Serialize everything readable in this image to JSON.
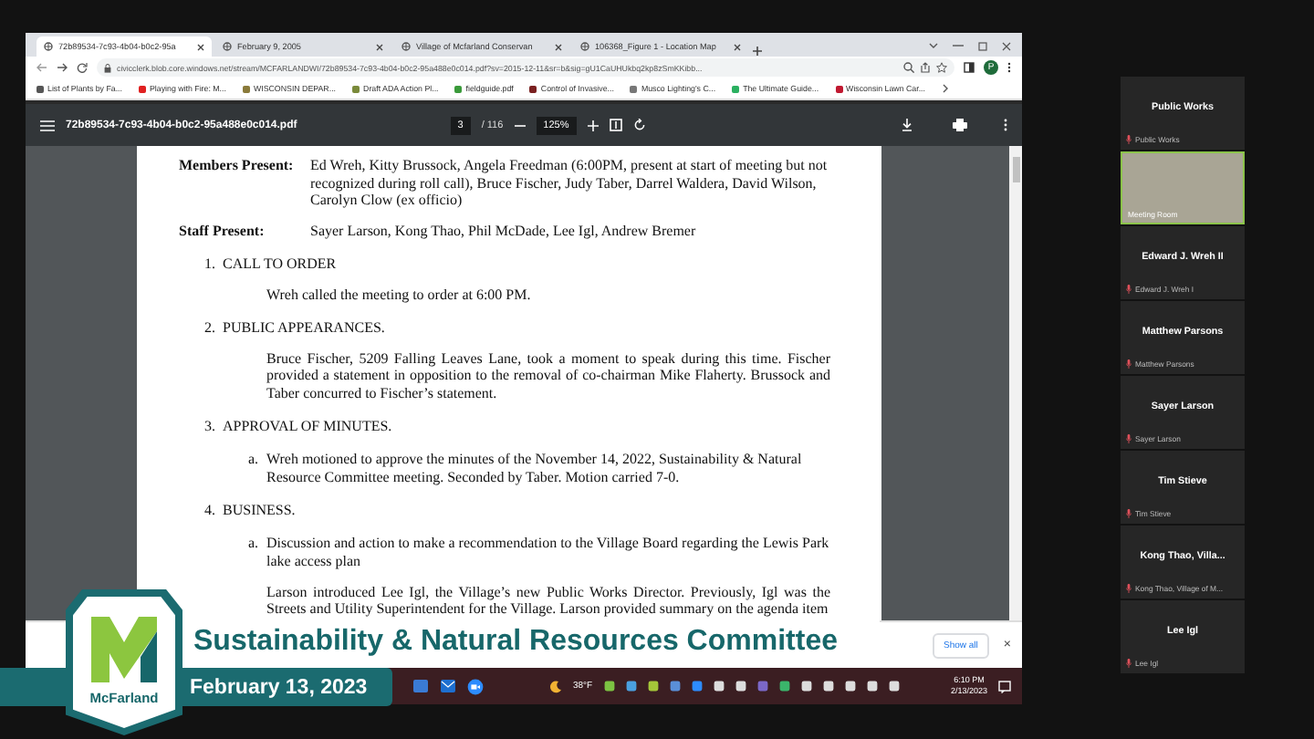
{
  "browser": {
    "tabs": [
      {
        "title": "72b89534-7c93-4b04-b0c2-95a",
        "selected": true
      },
      {
        "title": "February 9, 2005",
        "selected": false
      },
      {
        "title": "Village of Mcfarland Conservan",
        "selected": false
      },
      {
        "title": "106368_Figure 1 - Location Map",
        "selected": false
      }
    ],
    "address": "civicclerk.blob.core.windows.net/stream/MCFARLANDWI/72b89534-7c93-4b04-b0c2-95a488e0c014.pdf?sv=2015-12-11&sr=b&sig=gU1CaUHUkbq2kp8zSmKKibb...",
    "profile_initial": "P",
    "bookmarks": [
      {
        "title": "List of Plants by Fa...",
        "color": "#555555"
      },
      {
        "title": "Playing with Fire: M...",
        "color": "#e02020"
      },
      {
        "title": "WISCONSIN DEPAR...",
        "color": "#8a7a3a"
      },
      {
        "title": "Draft ADA Action Pl...",
        "color": "#7a8a3a"
      },
      {
        "title": "fieldguide.pdf",
        "color": "#3a9a3a"
      },
      {
        "title": "Control of Invasive...",
        "color": "#7a2020"
      },
      {
        "title": "Musco Lighting's C...",
        "color": "#777777"
      },
      {
        "title": "The Ultimate Guide...",
        "color": "#2ab060"
      },
      {
        "title": "Wisconsin Lawn Car...",
        "color": "#c01830"
      }
    ]
  },
  "pdf_viewer": {
    "filename": "72b89534-7c93-4b04-b0c2-95a488e0c014.pdf",
    "page": "3",
    "page_total": "/ 116",
    "zoom": "125%"
  },
  "document": [
    {
      "kind": "field",
      "label": "Members Present:",
      "text": "Ed Wreh, Kitty Brussock, Angela Freedman (6:00PM, present at start of meeting but not recognized during roll call), Bruce Fischer, Judy Taber, Darrel Waldera, David Wilson, Carolyn Clow (ex officio)"
    },
    {
      "kind": "field",
      "label": "Staff Present:",
      "text": "Sayer Larson, Kong Thao, Phil McDade, Lee Igl, Andrew Bremer"
    },
    {
      "kind": "heading",
      "marker": "1.",
      "text": "CALL TO ORDER"
    },
    {
      "kind": "para",
      "text": "Wreh called the meeting to order at 6:00 PM."
    },
    {
      "kind": "heading",
      "marker": "2.",
      "text": "PUBLIC APPEARANCES."
    },
    {
      "kind": "para",
      "text": "Bruce Fischer, 5209 Falling Leaves Lane, took a moment to speak during this time. Fischer provided a statement in opposition to the removal of co-chairman Mike Flaherty. Brussock and Taber concurred to Fischer’s statement."
    },
    {
      "kind": "heading",
      "marker": "3.",
      "text": "APPROVAL OF MINUTES."
    },
    {
      "kind": "item",
      "marker": "a.",
      "text": "Wreh motioned to approve the minutes of the November 14, 2022, Sustainability & Natural Resource Committee meeting. Seconded by Taber. Motion carried 7-0."
    },
    {
      "kind": "heading",
      "marker": "4.",
      "text": "BUSINESS."
    },
    {
      "kind": "item",
      "marker": "a.",
      "text": "Discussion and action to make a recommendation to the Village Board regarding the Lewis Park lake access plan"
    },
    {
      "kind": "para",
      "text": "Larson introduced Lee Igl, the Village’s new Public Works Director. Previously, Igl was the Streets and Utility Superintendent for the Village. Larson provided summary on the agenda item"
    }
  ],
  "downloads": {
    "show_all": "Show all",
    "close": "×"
  },
  "taskbar": {
    "temperature": "38°F",
    "time": "6:10 PM",
    "date": "2/13/2023"
  },
  "overlay": {
    "logo_text": "McFarland",
    "title": "Sustainability & Natural Resources Committee",
    "date": "February 13, 2023"
  },
  "participants": [
    {
      "kind": "name",
      "name": "Public Works",
      "label": "Public Works"
    },
    {
      "kind": "video",
      "label": "Meeting Room"
    },
    {
      "kind": "name",
      "name": "Edward J. Wreh II",
      "label": "Edward J. Wreh I"
    },
    {
      "kind": "name",
      "name": "Matthew Parsons",
      "label": "Matthew Parsons"
    },
    {
      "kind": "name",
      "name": "Sayer Larson",
      "label": "Sayer Larson"
    },
    {
      "kind": "name",
      "name": "Tim Stieve",
      "label": "Tim Stieve"
    },
    {
      "kind": "name",
      "name": "Kong Thao, Villa...",
      "label": "Kong Thao, Village of M..."
    },
    {
      "kind": "name",
      "name": "Lee Igl",
      "label": "Lee Igl"
    }
  ]
}
